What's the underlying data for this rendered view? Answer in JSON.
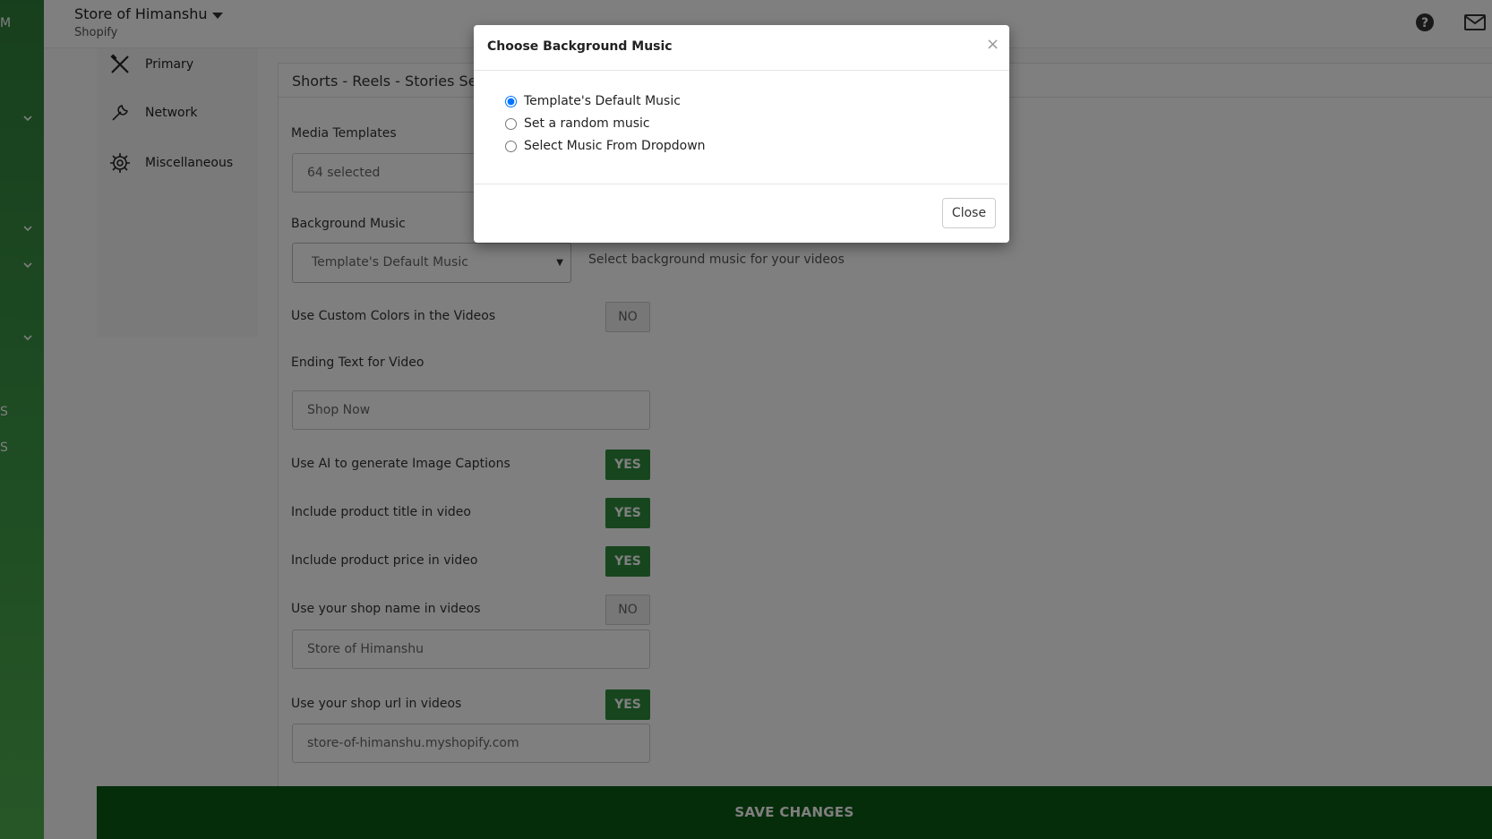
{
  "sidebar": {
    "fragments": [
      "M",
      "S",
      "S",
      "S"
    ]
  },
  "header": {
    "store_name": "Store of Himanshu",
    "platform": "Shopify"
  },
  "left_nav": {
    "items": [
      {
        "label": "Primary",
        "icon": "tools-icon"
      },
      {
        "label": "Network",
        "icon": "wrench-icon"
      },
      {
        "label": "Miscellaneous",
        "icon": "gear-icon"
      }
    ]
  },
  "panel": {
    "title": "Shorts - Reels - Stories Sett"
  },
  "form": {
    "media_templates_label": "Media Templates",
    "media_templates_value": "64 selected",
    "background_music_label": "Background Music",
    "background_music_value": "Template's Default Music",
    "background_music_hint": "Select background music for your videos",
    "custom_colors_label": "Use Custom Colors in the Videos",
    "custom_colors_toggle": "NO",
    "ending_text_label": "Ending Text for Video",
    "ending_text_value": "Shop Now",
    "ai_captions_label": "Use AI to generate Image Captions",
    "ai_captions_toggle": "YES",
    "product_title_label": "Include product title in video",
    "product_title_toggle": "YES",
    "product_price_label": "Include product price in video",
    "product_price_toggle": "YES",
    "shop_name_label": "Use your shop name in videos",
    "shop_name_toggle": "NO",
    "shop_name_value": "Store of  Himanshu",
    "shop_url_label": "Use your shop url in videos",
    "shop_url_toggle": "YES",
    "shop_url_value": "store-of-himanshu.myshopify.com"
  },
  "save_button": "SAVE CHANGES",
  "modal": {
    "title": "Choose Background Music",
    "close_x": "×",
    "options": [
      {
        "label": "Template's Default Music",
        "checked": true
      },
      {
        "label": "Set a random music",
        "checked": false
      },
      {
        "label": "Select Music From Dropdown",
        "checked": false
      }
    ],
    "close_button": "Close"
  },
  "colors": {
    "brand_green": "#2e8b3c",
    "save_bar": "#0d5a14",
    "sidebar_green": "#3e9a47"
  }
}
